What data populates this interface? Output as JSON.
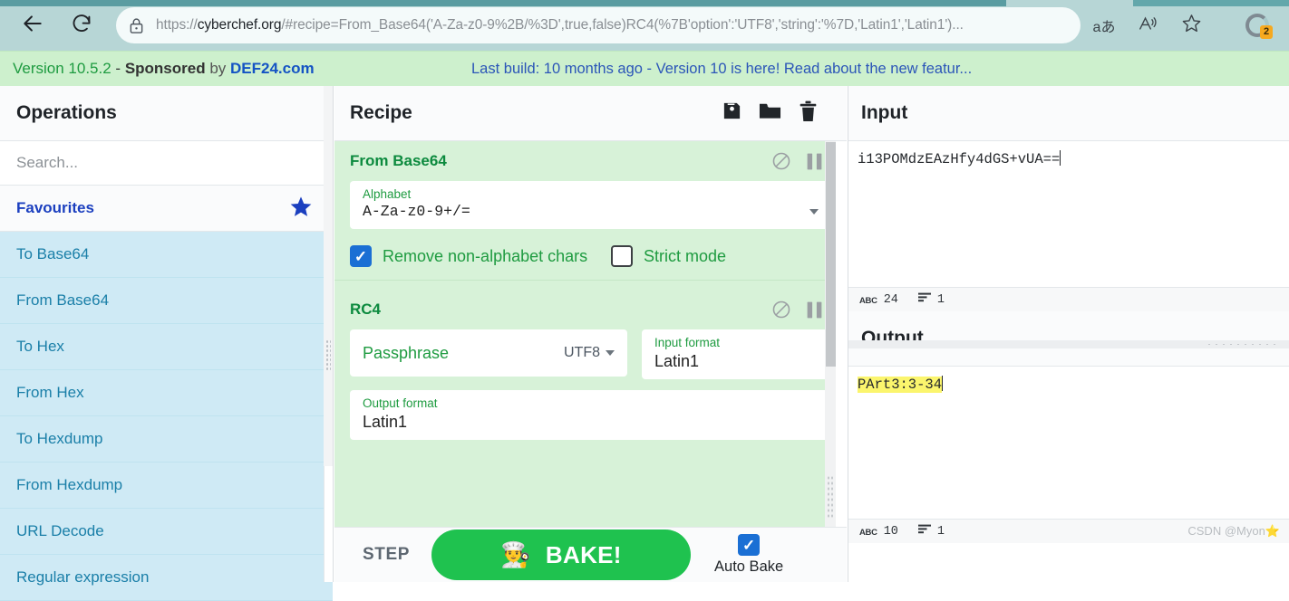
{
  "browser": {
    "back_icon": "arrow-left-icon",
    "reload_icon": "reload-icon",
    "site_info_icon": "lock-icon",
    "url_prefix": "https://",
    "url_host": "cyberchef.org",
    "url_path": "/#recipe=From_Base64('A-Za-z0-9%2B/%3D',true,false)RC4(%7B'option':'UTF8','string':'%7D,'Latin1','Latin1')...",
    "translate_icon": "aあ",
    "read_aloud_icon": "read-aloud-icon",
    "favorite_icon": "star-icon",
    "extension_badge_count": "2"
  },
  "banner": {
    "version": "Version 10.5.2",
    "separator": " - ",
    "sponsored": "Sponsored",
    "by": " by ",
    "sponsor_name": "DEF24.com",
    "build_notice": "Last build: 10 months ago - Version 10 is here! Read about the new featur..."
  },
  "operations": {
    "title": "Operations",
    "search_placeholder": "Search...",
    "search_value": "",
    "favourites_label": "Favourites",
    "favourites_star_icon": "star-filled-icon",
    "items": [
      {
        "label": "To Base64"
      },
      {
        "label": "From Base64"
      },
      {
        "label": "To Hex"
      },
      {
        "label": "From Hex"
      },
      {
        "label": "To Hexdump"
      },
      {
        "label": "From Hexdump"
      },
      {
        "label": "URL Decode"
      },
      {
        "label": "Regular expression"
      }
    ]
  },
  "recipe": {
    "title": "Recipe",
    "save_icon": "save-icon",
    "load_icon": "folder-icon",
    "clear_icon": "trash-icon",
    "operations": [
      {
        "name": "From Base64",
        "disable_icon": "disable-icon",
        "breakpoint_icon": "pause-icon",
        "args": [
          {
            "label": "Alphabet",
            "value": "A-Za-z0-9+/=",
            "type": "select"
          }
        ],
        "checkboxes": [
          {
            "label": "Remove non-alphabet chars",
            "checked": true
          },
          {
            "label": "Strict mode",
            "checked": false
          }
        ]
      },
      {
        "name": "RC4",
        "disable_icon": "disable-icon",
        "breakpoint_icon": "pause-icon",
        "passphrase": {
          "label": "Passphrase",
          "value": "",
          "encoding": "UTF8"
        },
        "args": [
          {
            "label": "Input format",
            "value": "Latin1",
            "type": "select"
          },
          {
            "label": "Output format",
            "value": "Latin1",
            "type": "select"
          }
        ]
      }
    ]
  },
  "controls": {
    "step_label": "STEP",
    "bake_label": "BAKE!",
    "bake_emoji": "👨‍🍳",
    "auto_bake_label": "Auto Bake",
    "auto_bake_checked": true
  },
  "input": {
    "title": "Input",
    "value": "i13POMdzEAzHfy4dGS+vUA==",
    "status": {
      "length_icon": "abc-icon",
      "length": "24",
      "lines_icon": "lines-icon",
      "lines": "1"
    }
  },
  "output": {
    "title": "Output",
    "value": "PArt3:3-34",
    "highlighted": true,
    "status": {
      "length_icon": "abc-icon",
      "length": "10",
      "lines_icon": "lines-icon",
      "lines": "1"
    },
    "watermark": "CSDN @Myon⭐"
  },
  "colors": {
    "banner_bg": "#cdf0cd",
    "recipe_bg": "#d7f2d8",
    "op_list_bg": "#cfeaf5",
    "bake_green": "#1fc24f",
    "accent_blue": "#1a6fd4",
    "highlight_yellow": "#fbf56d",
    "op_title_green": "#0c8a3e"
  }
}
